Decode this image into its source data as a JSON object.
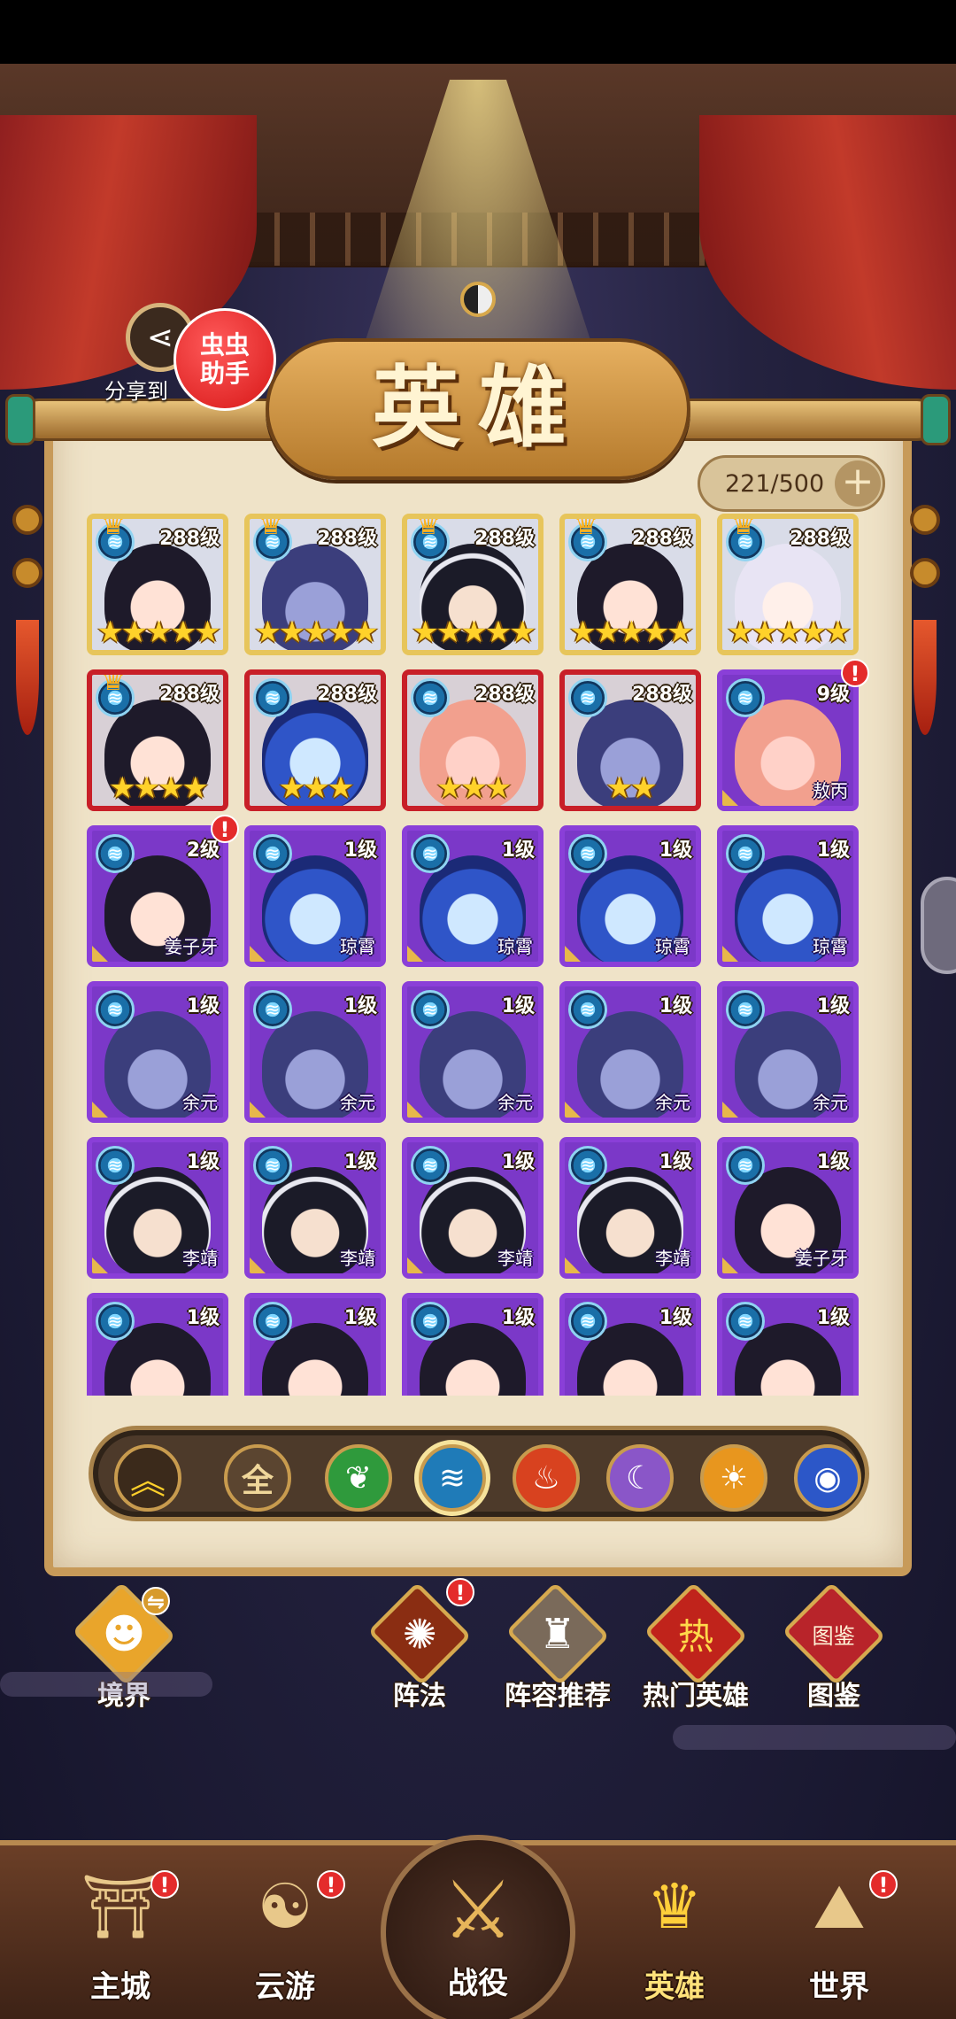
{
  "header": {
    "title": "英雄",
    "share_label": "分享到",
    "helper_label": "虫虫助手",
    "hero_count": "221/500",
    "add_symbol": "+"
  },
  "heroes": [
    {
      "level": "288级",
      "stars": "★★★★★",
      "name": "",
      "frame": "gold",
      "art": "dark",
      "flame": true,
      "alert": false
    },
    {
      "level": "288级",
      "stars": "★★★★★",
      "name": "",
      "frame": "gold",
      "art": "grey",
      "flame": true,
      "alert": false
    },
    {
      "level": "288级",
      "stars": "★★★★★",
      "name": "",
      "frame": "gold",
      "art": "helm",
      "flame": true,
      "alert": false
    },
    {
      "level": "288级",
      "stars": "★★★★★",
      "name": "",
      "frame": "gold",
      "art": "dark",
      "flame": true,
      "alert": false
    },
    {
      "level": "288级",
      "stars": "★★★★★",
      "name": "",
      "frame": "gold",
      "art": "white",
      "flame": true,
      "alert": false
    },
    {
      "level": "288级",
      "stars": "★★★★",
      "name": "",
      "frame": "red",
      "art": "dark",
      "flame": true,
      "alert": false
    },
    {
      "level": "288级",
      "stars": "★★★",
      "name": "",
      "frame": "red",
      "art": "blue",
      "flame": false,
      "alert": false
    },
    {
      "level": "288级",
      "stars": "★★★",
      "name": "",
      "frame": "red",
      "art": "pink",
      "flame": false,
      "alert": false
    },
    {
      "level": "288级",
      "stars": "★★",
      "name": "",
      "frame": "red",
      "art": "grey",
      "flame": false,
      "alert": false
    },
    {
      "level": "9级",
      "stars": "",
      "name": "敖丙",
      "frame": "purple",
      "art": "pink",
      "flame": false,
      "alert": true
    },
    {
      "level": "2级",
      "stars": "",
      "name": "姜子牙",
      "frame": "purple",
      "art": "dark",
      "flame": false,
      "alert": true
    },
    {
      "level": "1级",
      "stars": "",
      "name": "琼霄",
      "frame": "purple",
      "art": "blue",
      "flame": false,
      "alert": false
    },
    {
      "level": "1级",
      "stars": "",
      "name": "琼霄",
      "frame": "purple",
      "art": "blue",
      "flame": false,
      "alert": false
    },
    {
      "level": "1级",
      "stars": "",
      "name": "琼霄",
      "frame": "purple",
      "art": "blue",
      "flame": false,
      "alert": false
    },
    {
      "level": "1级",
      "stars": "",
      "name": "琼霄",
      "frame": "purple",
      "art": "blue",
      "flame": false,
      "alert": false
    },
    {
      "level": "1级",
      "stars": "",
      "name": "余元",
      "frame": "purple",
      "art": "grey",
      "flame": false,
      "alert": false
    },
    {
      "level": "1级",
      "stars": "",
      "name": "余元",
      "frame": "purple",
      "art": "grey",
      "flame": false,
      "alert": false
    },
    {
      "level": "1级",
      "stars": "",
      "name": "余元",
      "frame": "purple",
      "art": "grey",
      "flame": false,
      "alert": false
    },
    {
      "level": "1级",
      "stars": "",
      "name": "余元",
      "frame": "purple",
      "art": "grey",
      "flame": false,
      "alert": false
    },
    {
      "level": "1级",
      "stars": "",
      "name": "余元",
      "frame": "purple",
      "art": "grey",
      "flame": false,
      "alert": false
    },
    {
      "level": "1级",
      "stars": "",
      "name": "李靖",
      "frame": "purple",
      "art": "helm",
      "flame": false,
      "alert": false
    },
    {
      "level": "1级",
      "stars": "",
      "name": "李靖",
      "frame": "purple",
      "art": "helm",
      "flame": false,
      "alert": false
    },
    {
      "level": "1级",
      "stars": "",
      "name": "李靖",
      "frame": "purple",
      "art": "helm",
      "flame": false,
      "alert": false
    },
    {
      "level": "1级",
      "stars": "",
      "name": "李靖",
      "frame": "purple",
      "art": "helm",
      "flame": false,
      "alert": false
    },
    {
      "level": "1级",
      "stars": "",
      "name": "姜子牙",
      "frame": "purple",
      "art": "dark",
      "flame": false,
      "alert": false
    },
    {
      "level": "1级",
      "stars": "",
      "name": "",
      "frame": "purple",
      "art": "dark",
      "flame": false,
      "alert": false
    },
    {
      "level": "1级",
      "stars": "",
      "name": "",
      "frame": "purple",
      "art": "dark",
      "flame": false,
      "alert": false
    },
    {
      "level": "1级",
      "stars": "",
      "name": "",
      "frame": "purple",
      "art": "dark",
      "flame": false,
      "alert": false
    },
    {
      "level": "1级",
      "stars": "",
      "name": "",
      "frame": "purple",
      "art": "dark",
      "flame": false,
      "alert": false
    },
    {
      "level": "1级",
      "stars": "",
      "name": "",
      "frame": "purple",
      "art": "dark",
      "flame": false,
      "alert": false
    }
  ],
  "filters": [
    {
      "name": "sort-up",
      "glyph": "︽",
      "bg": "#3b2a1b"
    },
    {
      "name": "all",
      "glyph": "全",
      "bg": "#5b4530"
    },
    {
      "name": "wood-element",
      "glyph": "❦",
      "bg": "#2f9a3c"
    },
    {
      "name": "water-element",
      "glyph": "≋",
      "bg": "#1f7bb8",
      "active": true
    },
    {
      "name": "fire-element",
      "glyph": "♨",
      "bg": "#d8421f"
    },
    {
      "name": "moon-element",
      "glyph": "☾",
      "bg": "#8a56c8"
    },
    {
      "name": "sun-element",
      "glyph": "☀",
      "bg": "#e8961e"
    },
    {
      "name": "wind-element",
      "glyph": "◉",
      "bg": "#2c57c8"
    }
  ],
  "menu": {
    "realm": "境界",
    "formation": "阵法",
    "recommended_lineup": "阵容推荐",
    "popular_heroes": "热门英雄",
    "codex": "图鉴",
    "popular_badge": "热",
    "codex_badge": "图鉴"
  },
  "nav": {
    "main_city": "主城",
    "travel": "云游",
    "battle": "战役",
    "heroes": "英雄",
    "world": "世界"
  },
  "alert_mark": "!",
  "colors": {
    "accent_gold": "#e7c55b",
    "frame_red": "#c81f28",
    "frame_purple": "#8a3fd8",
    "alert_red": "#e42b2b",
    "parchment": "#efe3c8"
  }
}
